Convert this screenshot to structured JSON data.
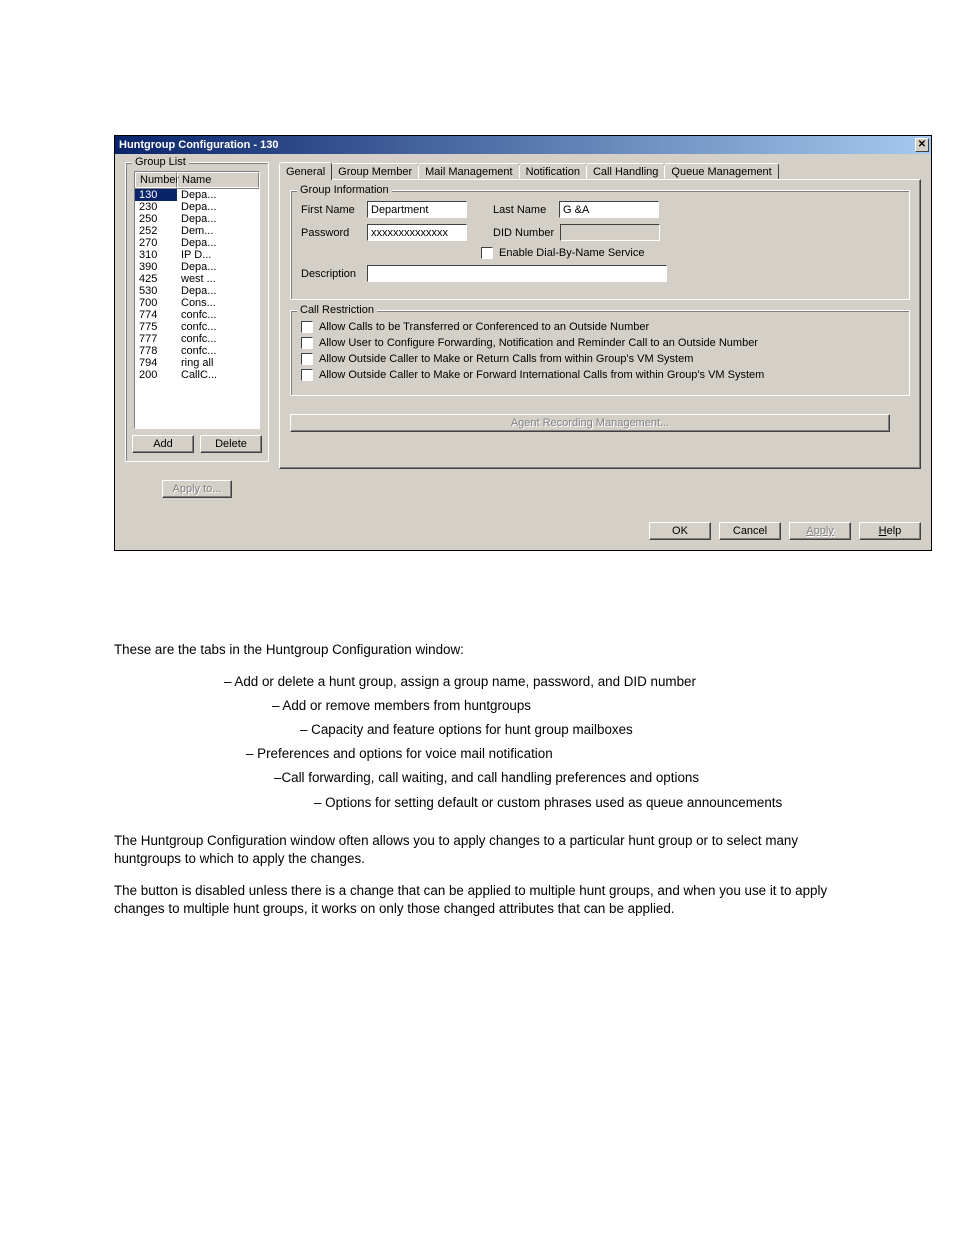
{
  "dialog": {
    "title": "Huntgroup Configuration - 130",
    "close_icon": "x",
    "group_list": {
      "legend": "Group List",
      "col_number": "Number",
      "col_name": "Name",
      "rows": [
        {
          "num": "130",
          "name": "Depa...",
          "selected": true
        },
        {
          "num": "230",
          "name": "Depa..."
        },
        {
          "num": "250",
          "name": "Depa..."
        },
        {
          "num": "252",
          "name": "Dem..."
        },
        {
          "num": "270",
          "name": "Depa..."
        },
        {
          "num": "310",
          "name": "IP D..."
        },
        {
          "num": "390",
          "name": "Depa..."
        },
        {
          "num": "425",
          "name": "west ..."
        },
        {
          "num": "530",
          "name": "Depa..."
        },
        {
          "num": "700",
          "name": "Cons..."
        },
        {
          "num": "774",
          "name": "confc..."
        },
        {
          "num": "775",
          "name": "confc..."
        },
        {
          "num": "777",
          "name": "confc..."
        },
        {
          "num": "778",
          "name": "confc..."
        },
        {
          "num": "794",
          "name": "ring all"
        },
        {
          "num": "200",
          "name": "CallC..."
        }
      ],
      "add_btn": "Add",
      "delete_btn": "Delete",
      "apply_to_btn": "Apply to..."
    },
    "tabs": {
      "general": "General",
      "group_member": "Group Member",
      "mail_management": "Mail Management",
      "notification": "Notification",
      "call_handling": "Call Handling",
      "queue_management": "Queue Management"
    },
    "general_tab": {
      "group_info_legend": "Group Information",
      "first_name_label": "First Name",
      "first_name_value": "Department",
      "last_name_label": "Last Name",
      "last_name_value": "G &A",
      "password_label": "Password",
      "password_value": "xxxxxxxxxxxxxx",
      "did_label": "DID Number",
      "did_value": "",
      "enable_dbn": "Enable Dial-By-Name Service",
      "description_label": "Description",
      "description_value": "",
      "call_restriction_legend": "Call Restriction",
      "cr1": "Allow Calls to be Transferred or Conferenced to an Outside Number",
      "cr2": "Allow User to Configure Forwarding, Notification and Reminder Call to an Outside Number",
      "cr3": "Allow Outside Caller to Make or Return Calls from within Group's VM System",
      "cr4": "Allow Outside Caller to Make or Forward International Calls from within Group's VM System",
      "agent_rec_btn": "Agent Recording Management..."
    },
    "buttons": {
      "ok": "OK",
      "cancel": "Cancel",
      "apply": "Apply",
      "help": "Help"
    }
  },
  "doc": {
    "intro": "These are the tabs in the Huntgroup Configuration window:",
    "li1": " – Add or delete a hunt group, assign a group name, password, and DID number",
    "li2": " – Add or remove members from huntgroups",
    "li3": " – Capacity and feature options for hunt group mailboxes",
    "li4": " – Preferences and options for voice mail notification",
    "li5": " –Call forwarding, call waiting, and call handling preferences and options",
    "li6": " – Options for setting default or custom phrases used as queue announcements",
    "p2": "The Huntgroup Configuration window often allows you to apply changes to a particular hunt group or to select many huntgroups to which to apply the changes.",
    "p3_a": "The ",
    "p3_b": " button is disabled unless there is a change that can be applied to multiple hunt groups, and when you use it to apply changes to multiple hunt groups, it works on only those changed attributes that can be applied."
  }
}
